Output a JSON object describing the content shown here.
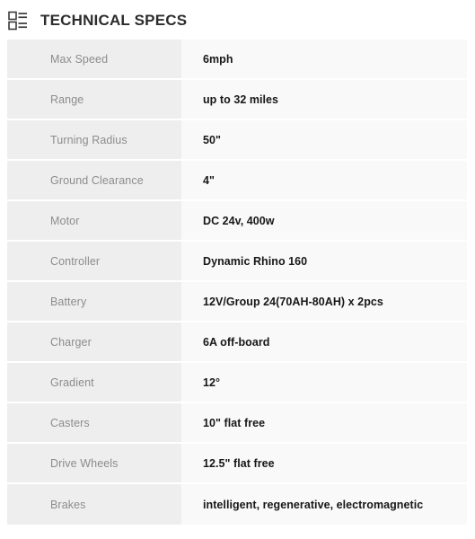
{
  "header": {
    "icon": "list-detail-icon",
    "title": "TECHNICAL SPECS"
  },
  "colors": {
    "page_background": "#ffffff",
    "label_cell_background": "#eeeeee",
    "value_cell_background": "#f9f9f9",
    "label_text": "#8c8c8c",
    "value_text": "#171717",
    "title_text": "#2c2c2c",
    "row_divider": "#ffffff"
  },
  "spec_table": {
    "rows": [
      {
        "label": "Max Speed",
        "value": "6mph"
      },
      {
        "label": "Range",
        "value": "up to 32 miles"
      },
      {
        "label": "Turning Radius",
        "value": "50\""
      },
      {
        "label": "Ground Clearance",
        "value": "4\""
      },
      {
        "label": "Motor",
        "value": "DC 24v, 400w"
      },
      {
        "label": "Controller",
        "value": "Dynamic Rhino 160"
      },
      {
        "label": "Battery",
        "value": "12V/Group 24(70AH-80AH) x 2pcs"
      },
      {
        "label": "Charger",
        "value": "6A off-board"
      },
      {
        "label": "Gradient",
        "value": "12°"
      },
      {
        "label": "Casters",
        "value": "10\" flat free"
      },
      {
        "label": "Drive Wheels",
        "value": "12.5\" flat free"
      },
      {
        "label": "Brakes",
        "value": "intelligent, regenerative, electromagnetic"
      }
    ]
  }
}
